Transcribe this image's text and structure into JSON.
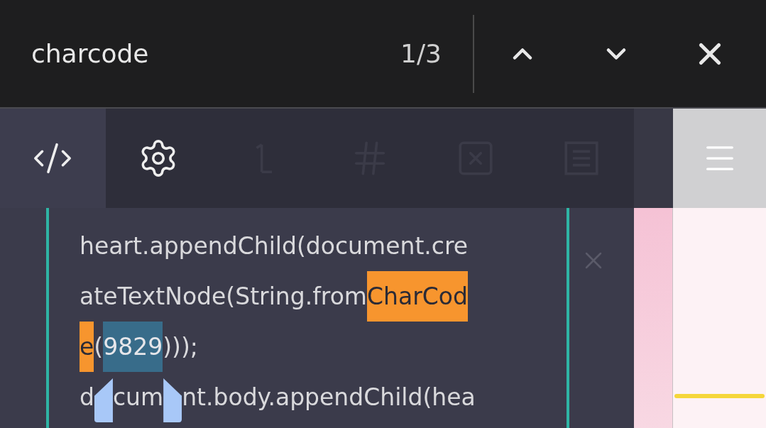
{
  "find_bar": {
    "query": "charcode",
    "count": "1/3"
  },
  "toolbar": {
    "tools": [
      {
        "kind": "code",
        "selected": true,
        "disabled": false
      },
      {
        "kind": "settings",
        "selected": false,
        "disabled": false
      },
      {
        "kind": "cursor",
        "selected": false,
        "disabled": true
      },
      {
        "kind": "hash",
        "selected": false,
        "disabled": true
      },
      {
        "kind": "clear",
        "selected": false,
        "disabled": true
      },
      {
        "kind": "list",
        "selected": false,
        "disabled": true
      }
    ]
  },
  "editor": {
    "lines": [
      [
        {
          "text": "heart.appendChild(document.cre",
          "kind": "plain"
        }
      ],
      [
        {
          "text": "ateTextNode(String.from",
          "kind": "plain"
        },
        {
          "text": "CharCod",
          "kind": "match"
        }
      ],
      [
        {
          "text": "e",
          "kind": "match"
        },
        {
          "text": "(",
          "kind": "plain"
        },
        {
          "text": "9829",
          "kind": "selection"
        },
        {
          "text": ")));",
          "kind": "plain"
        }
      ],
      [
        {
          "text": "d",
          "kind": "plain"
        },
        {
          "kind": "handle"
        },
        {
          "text": "cum",
          "kind": "plain"
        },
        {
          "kind": "handle"
        },
        {
          "text": "nt.body.appendChild(hea",
          "kind": "plain"
        }
      ]
    ]
  }
}
